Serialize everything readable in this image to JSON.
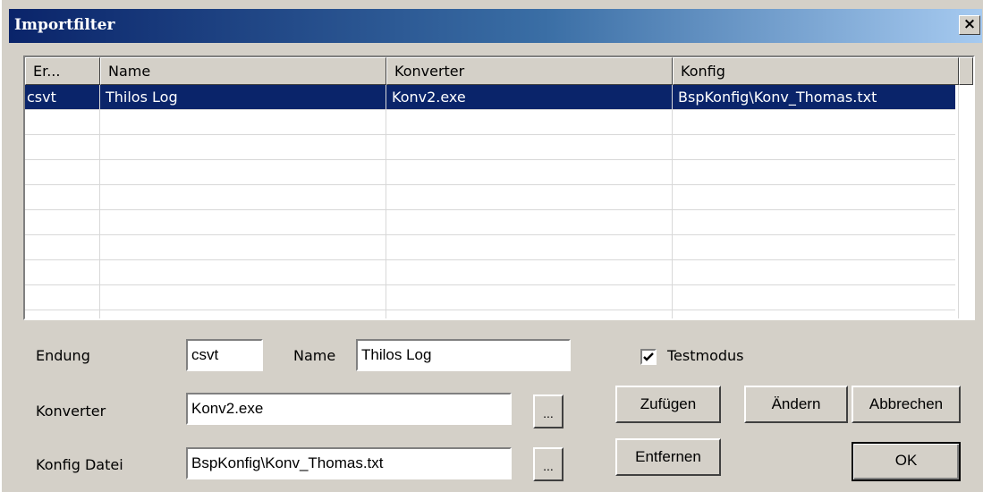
{
  "window": {
    "title": "Importfilter",
    "close_glyph": "×"
  },
  "list": {
    "columns": [
      "Er...",
      "Name",
      "Konverter",
      "Konfig"
    ],
    "rows": [
      {
        "ext": "csvt",
        "name": "Thilos Log",
        "converter": "Konv2.exe",
        "config": "BspKonfig\\Konv_Thomas.txt"
      }
    ]
  },
  "form": {
    "endung_label": "Endung",
    "endung_value": "csvt",
    "name_label": "Name",
    "name_value": "Thilos Log",
    "testmodus_label": "Testmodus",
    "testmodus_checked": true,
    "konverter_label": "Konverter",
    "konverter_value": "Konv2.exe",
    "konfig_label": "Konfig Datei",
    "konfig_value": "BspKonfig\\Konv_Thomas.txt",
    "browse_label": "..."
  },
  "buttons": {
    "add": "Zufügen",
    "change": "Ändern",
    "cancel": "Abbrechen",
    "remove": "Entfernen",
    "ok": "OK"
  },
  "icons": {
    "close": "close-icon",
    "check": "checkmark-icon"
  },
  "colors": {
    "selection": "#0a246a",
    "title_start": "#0a246a",
    "title_end": "#a6caf0",
    "face": "#d4d0c8"
  }
}
